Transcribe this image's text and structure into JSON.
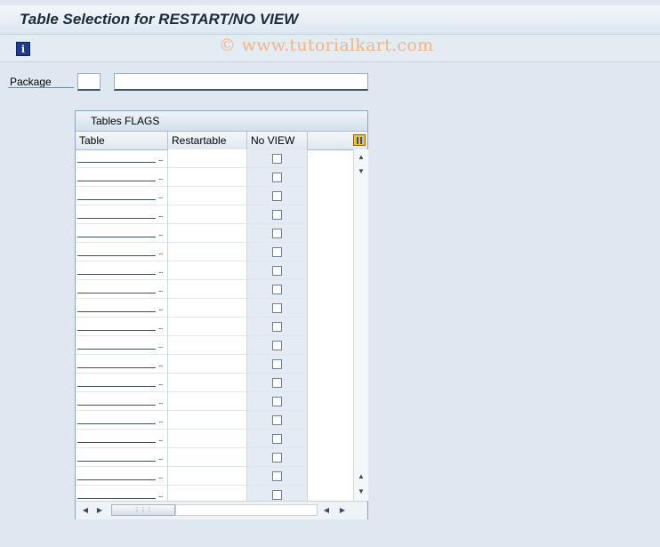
{
  "window": {
    "title": "Table Selection for RESTART/NO VIEW"
  },
  "toolbar": {
    "info_icon": "information-icon",
    "watermark": "© www.tutorialkart.com"
  },
  "form": {
    "package_label": "Package",
    "package_value": "",
    "package_description": ""
  },
  "table": {
    "title": "Tables FLAGS",
    "columns": [
      "Table",
      "Restartable",
      "No VIEW"
    ],
    "column_config_icon": "column-settings-icon",
    "row_count": 19,
    "rows": [
      {
        "table": "",
        "restartable": "",
        "no_view": false
      },
      {
        "table": "",
        "restartable": "",
        "no_view": false
      },
      {
        "table": "",
        "restartable": "",
        "no_view": false
      },
      {
        "table": "",
        "restartable": "",
        "no_view": false
      },
      {
        "table": "",
        "restartable": "",
        "no_view": false
      },
      {
        "table": "",
        "restartable": "",
        "no_view": false
      },
      {
        "table": "",
        "restartable": "",
        "no_view": false
      },
      {
        "table": "",
        "restartable": "",
        "no_view": false
      },
      {
        "table": "",
        "restartable": "",
        "no_view": false
      },
      {
        "table": "",
        "restartable": "",
        "no_view": false
      },
      {
        "table": "",
        "restartable": "",
        "no_view": false
      },
      {
        "table": "",
        "restartable": "",
        "no_view": false
      },
      {
        "table": "",
        "restartable": "",
        "no_view": false
      },
      {
        "table": "",
        "restartable": "",
        "no_view": false
      },
      {
        "table": "",
        "restartable": "",
        "no_view": false
      },
      {
        "table": "",
        "restartable": "",
        "no_view": false
      },
      {
        "table": "",
        "restartable": "",
        "no_view": false
      },
      {
        "table": "",
        "restartable": "",
        "no_view": false
      },
      {
        "table": "",
        "restartable": "",
        "no_view": false
      }
    ]
  },
  "colors": {
    "background": "#dfe8f1",
    "watermark": "#f0b58a",
    "info_icon": "#1d3b86"
  }
}
